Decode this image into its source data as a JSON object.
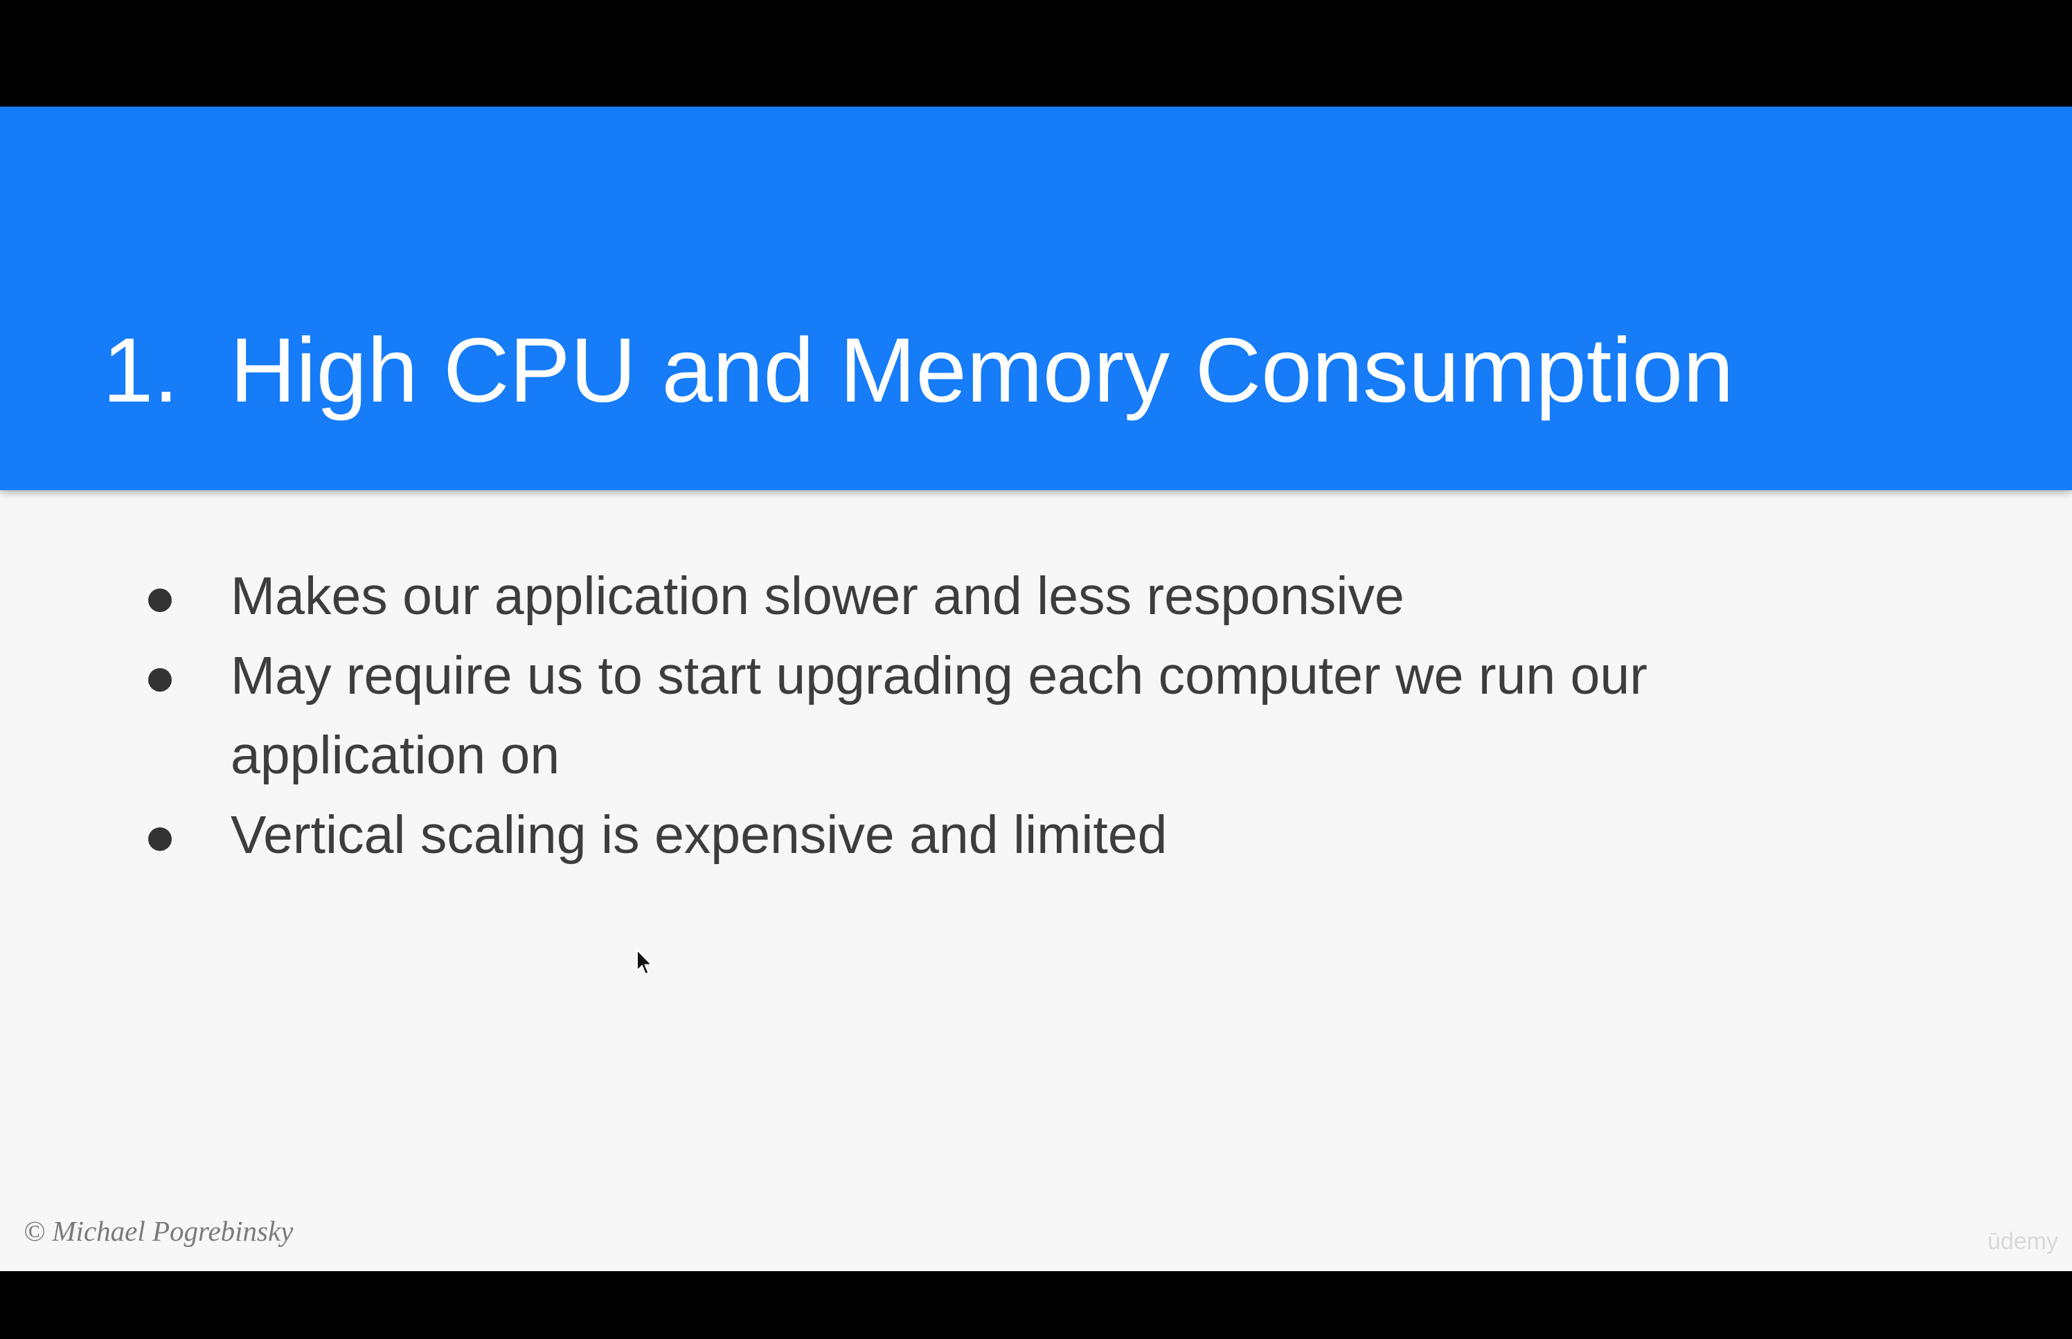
{
  "slide": {
    "title_number": "1.",
    "title_text": "High CPU and Memory Consumption",
    "bullets": [
      {
        "text": "Makes our application slower and less responsive"
      },
      {
        "text": "May require us to start upgrading each computer we run our application on"
      },
      {
        "text": "Vertical scaling is expensive and limited"
      }
    ],
    "copyright": "© Michael Pogrebinsky",
    "watermark": "ūdemy"
  },
  "colors": {
    "header_bg": "#167cf8",
    "slide_bg": "#f7f7f7",
    "letterbox": "#000000",
    "body_text": "#3d3d3d"
  },
  "icons": {
    "cursor": "mouse-pointer-icon"
  }
}
